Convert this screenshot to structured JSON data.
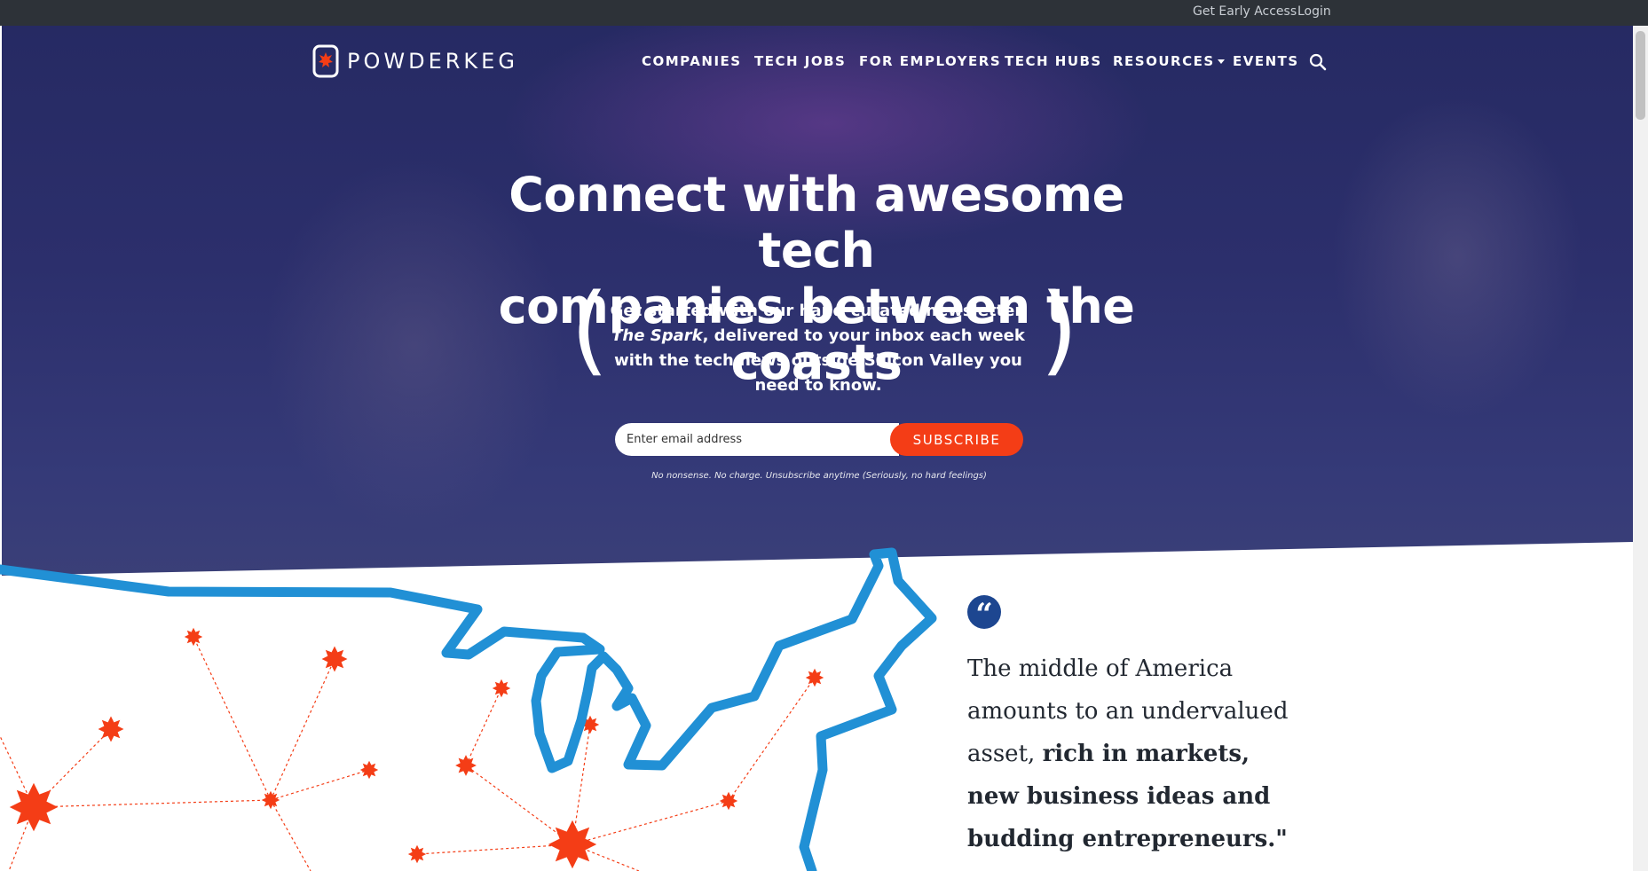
{
  "topbar": {
    "early_access": "Get Early Access",
    "login": "Login"
  },
  "brand": {
    "name": "POWDERKEG",
    "accent": "#f43d16",
    "navy": "#1d4690"
  },
  "nav": {
    "items": [
      "COMPANIES",
      "TECH JOBS",
      "FOR EMPLOYERS",
      "TECH HUBS",
      "RESOURCES",
      "EVENTS"
    ],
    "dropdown_item": "RESOURCES",
    "search_icon": "search-icon"
  },
  "hero": {
    "headline_line1": "Connect with awesome tech",
    "headline_line2": "companies between the coasts",
    "sub_pre": "Get started with our hand-curated newsletter, ",
    "sub_italic": "The Spark",
    "sub_post": ", delivered to your inbox each week with the tech news outside Silicon Valley you need to know.",
    "paren_open": "(",
    "paren_close": ")",
    "email_placeholder": "Enter email address",
    "subscribe_label": "SUBSCRIBE",
    "disclaimer": "No nonsense. No charge. Unsubscribe anytime (Seriously, no hard feelings)"
  },
  "quote": {
    "mark": "“",
    "plain": "The middle of America amounts to an undervalued asset, ",
    "bold": "rich in markets, new business ideas and budding entrepreneurs.\""
  }
}
